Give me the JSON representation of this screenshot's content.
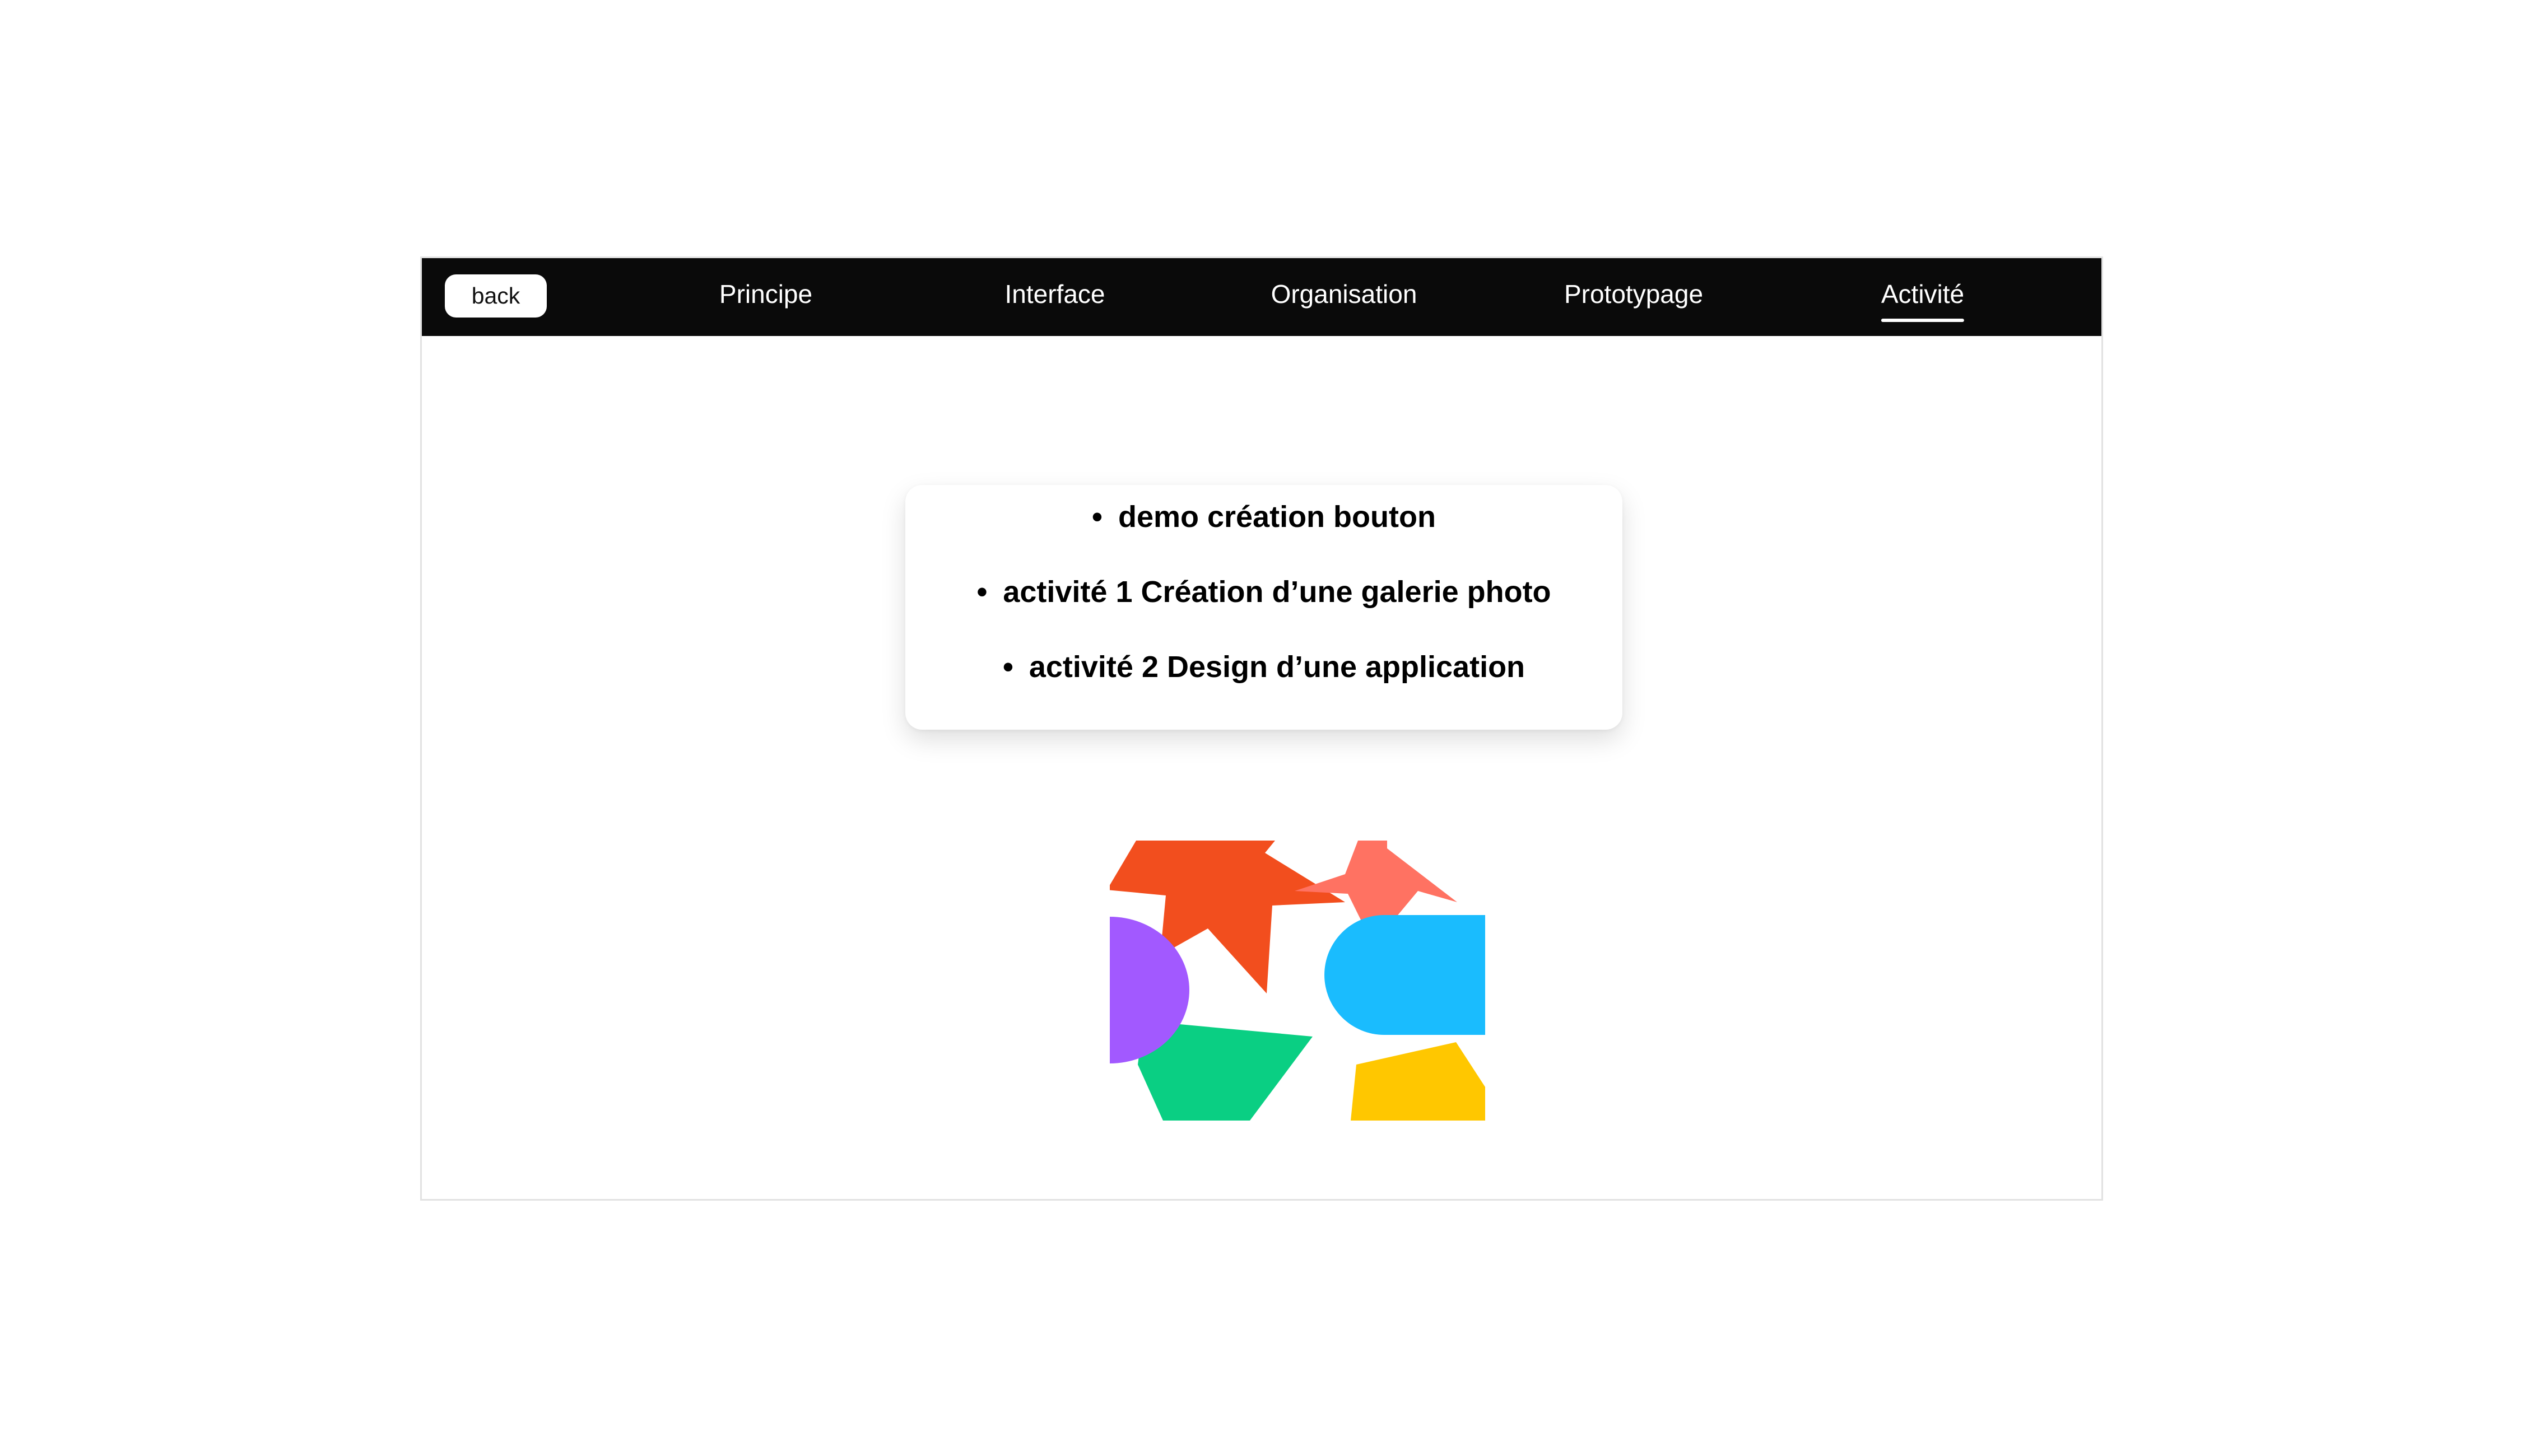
{
  "nav": {
    "back_label": "back",
    "items": [
      {
        "label": "Principe",
        "active": false
      },
      {
        "label": "Interface",
        "active": false
      },
      {
        "label": "Organisation",
        "active": false
      },
      {
        "label": "Prototypage",
        "active": false
      },
      {
        "label": "Activité",
        "active": true
      }
    ]
  },
  "activities": {
    "bullet": "•",
    "items": [
      "demo création bouton",
      "activité 1 Création d’une galerie photo",
      "activité 2 Design d’une application"
    ]
  },
  "illustration": {
    "shapes": [
      {
        "name": "orange-star-shape",
        "color": "#F24E1E"
      },
      {
        "name": "salmon-star-shape",
        "color": "#FF7262"
      },
      {
        "name": "purple-half-circle-shape",
        "color": "#A259FF"
      },
      {
        "name": "blue-rounded-rect-shape",
        "color": "#1ABCFE"
      },
      {
        "name": "green-trapezoid-shape",
        "color": "#0ACF83"
      },
      {
        "name": "yellow-quad-shape",
        "color": "#FFC700"
      }
    ]
  },
  "colors": {
    "navbar_bg": "#0A0A0A",
    "nav_text": "#FFFFFF"
  }
}
